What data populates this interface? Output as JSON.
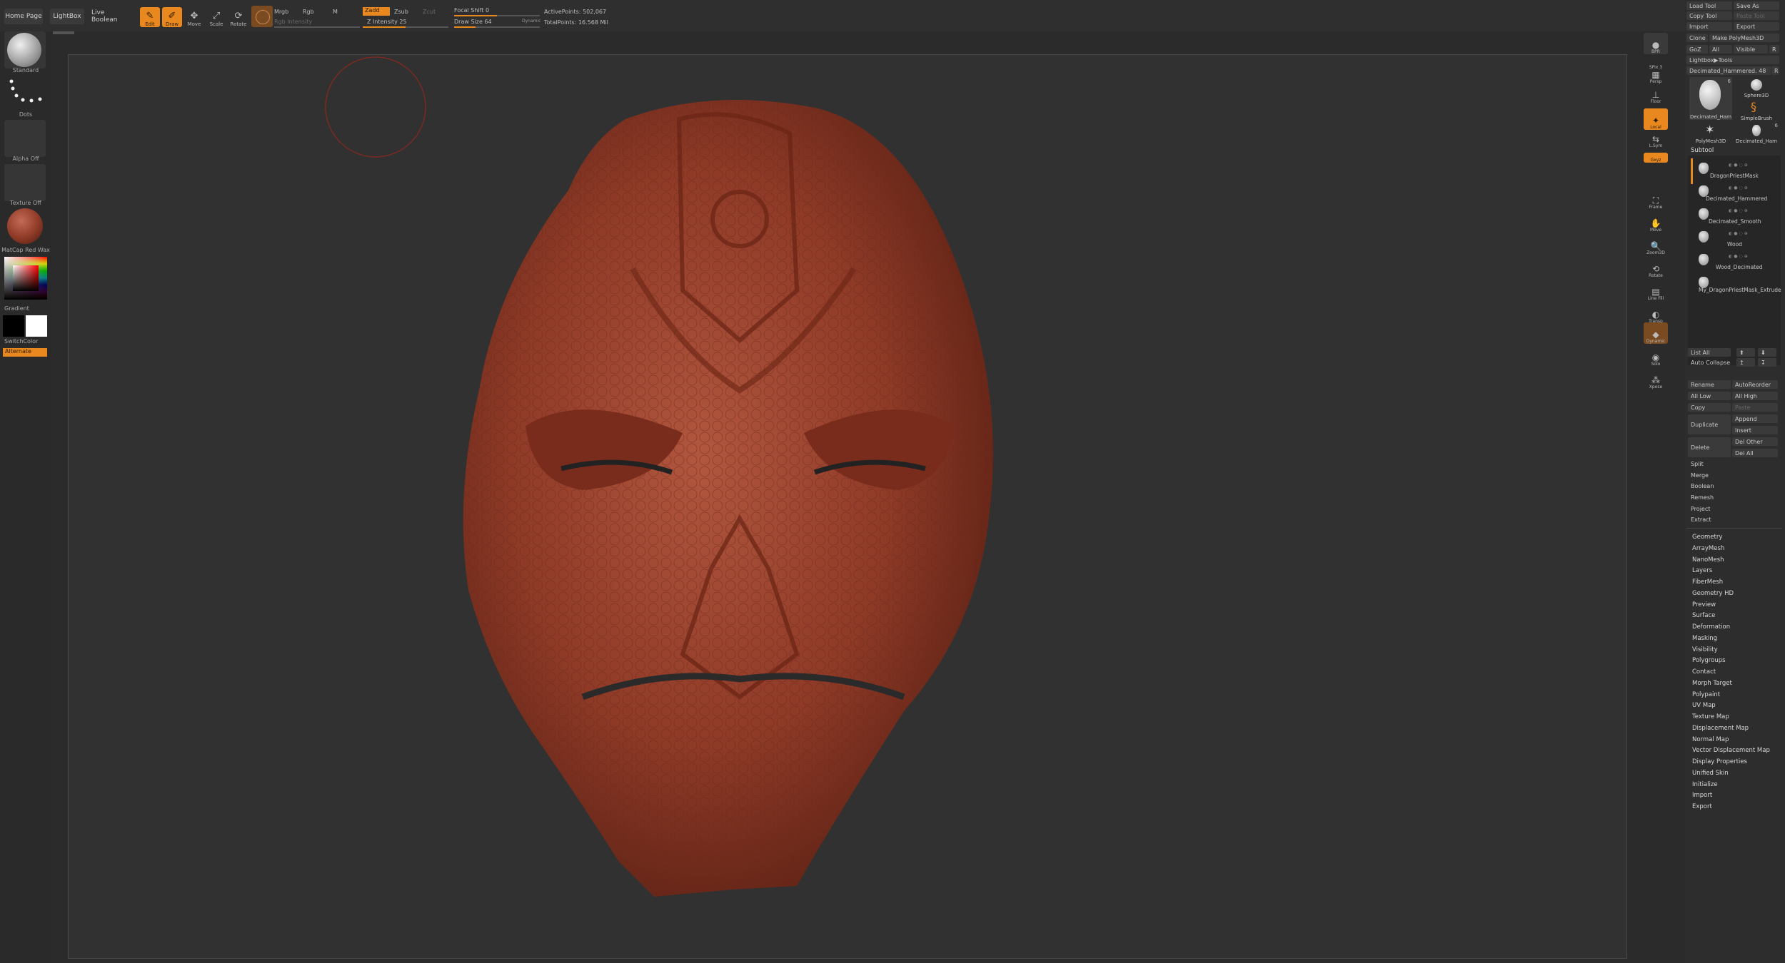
{
  "colors": {
    "accent": "#e8881f",
    "background": "#2b2b2b",
    "mesh": "#8e3a27"
  },
  "topbar": {
    "home_page": "Home Page",
    "lightbox": "LightBox",
    "live_boolean": "Live Boolean",
    "modes": [
      "Edit",
      "Draw",
      "Move",
      "Scale",
      "Rotate"
    ],
    "mrgb": "Mrgb",
    "rgb": "Rgb",
    "m": "M",
    "rgb_intensity": "Rgb Intensity",
    "zadd": "Zadd",
    "zsub": "Zsub",
    "zcut": "Zcut",
    "z_intensity": "Z Intensity 25",
    "focal_shift": "Focal Shift 0",
    "draw_size": "Draw Size 64",
    "dynamic": "Dynamic",
    "active_points": "ActivePoints: 502,067",
    "total_points": "TotalPoints: 16.568 Mil"
  },
  "left_shelf": {
    "brush": "Standard",
    "stroke": "Dots",
    "alpha": "Alpha Off",
    "texture": "Texture Off",
    "material": "MatCap Red Wax",
    "gradient": "Gradient",
    "switch_color": "SwitchColor",
    "alternate": "Alternate"
  },
  "right_shelf": [
    {
      "icon": "bpr-icon",
      "label": "BPR"
    },
    {
      "icon": "spix-icon",
      "label": "SPix 3"
    },
    {
      "icon": "persp-icon",
      "label": "Persp"
    },
    {
      "icon": "floor-icon",
      "label": "Floor"
    },
    {
      "icon": "local-icon",
      "label": "Local"
    },
    {
      "icon": "xyz-icon",
      "label": "L.Sym"
    },
    {
      "icon": "gxyz-icon",
      "label": "Gxyz"
    },
    {
      "icon": "frame-icon",
      "label": "Frame"
    },
    {
      "icon": "move-icon",
      "label": "Move"
    },
    {
      "icon": "zoom3d-icon",
      "label": "Zoom3D"
    },
    {
      "icon": "rotate-icon",
      "label": "Rotate"
    },
    {
      "icon": "linefill-icon",
      "label": "Line Fill"
    },
    {
      "icon": "transp-icon",
      "label": "Transp"
    },
    {
      "icon": "dynamic-icon",
      "label": "Dynamic"
    },
    {
      "icon": "solo-icon",
      "label": "Solo"
    },
    {
      "icon": "xpose-icon",
      "label": "Xpose"
    }
  ],
  "tool": {
    "load_tool": "Load Tool",
    "save_as": "Save As",
    "copy_tool": "Copy Tool",
    "paste_tool": "Paste Tool",
    "import": "Import",
    "export": "Export",
    "clone": "Clone",
    "make_polymesh": "Make PolyMesh3D",
    "goz": "GoZ",
    "all": "All",
    "visible": "Visible",
    "r": "R",
    "lightbox_tools": "Lightbox▶Tools",
    "current_tool": "Decimated_Hammered. 48",
    "thumbs": [
      {
        "label": "Decimated_Ham",
        "count": "6"
      },
      {
        "label": "Sphere3D",
        "count": ""
      },
      {
        "label": "SimpleBrush",
        "count": ""
      },
      {
        "label": "PolyMesh3D",
        "count": ""
      },
      {
        "label": "Decimated_Ham",
        "count": "6"
      }
    ],
    "subtool_title": "Subtool",
    "subtools": [
      "DragonPriestMask",
      "Decimated_Hammered",
      "Decimated_Smooth",
      "Wood",
      "Wood_Decimated",
      "My_DragonPriestMask_Extrude"
    ],
    "list_all": "List All",
    "auto_collapse": "Auto Collapse",
    "ops": {
      "rename": "Rename",
      "autoreorder": "AutoReorder",
      "all_low": "All Low",
      "all_high": "All High",
      "copy": "Copy",
      "paste": "Paste",
      "duplicate": "Duplicate",
      "append": "Append",
      "insert": "Insert",
      "delete": "Delete",
      "del_other": "Del Other",
      "del_all": "Del All",
      "split": "Split",
      "merge": "Merge",
      "boolean": "Boolean",
      "remesh": "Remesh",
      "project": "Project",
      "extract": "Extract"
    },
    "menus": [
      "Geometry",
      "ArrayMesh",
      "NanoMesh",
      "Layers",
      "FiberMesh",
      "Geometry HD",
      "Preview",
      "Surface",
      "Deformation",
      "Masking",
      "Visibility",
      "Polygroups",
      "Contact",
      "Morph Target",
      "Polypaint",
      "UV Map",
      "Texture Map",
      "Displacement Map",
      "Normal Map",
      "Vector Displacement Map",
      "Display Properties",
      "Unified Skin",
      "Initialize",
      "Import",
      "Export"
    ]
  }
}
